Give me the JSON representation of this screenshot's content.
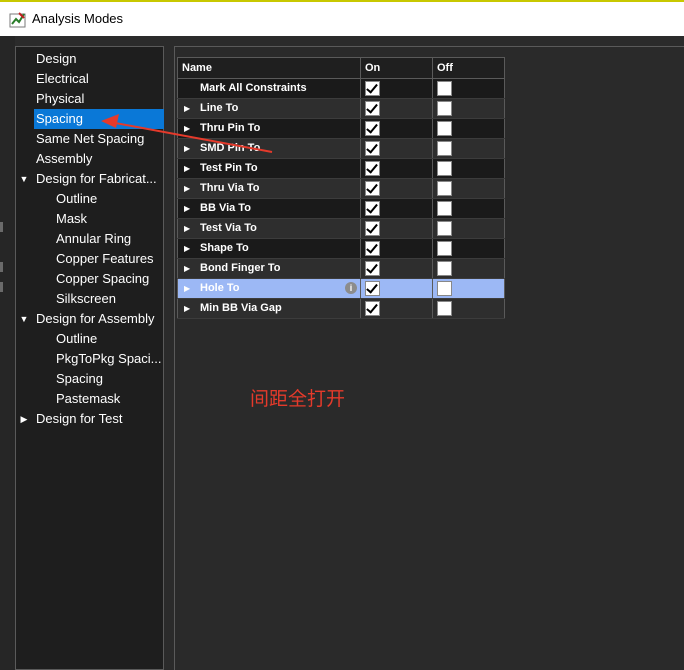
{
  "window": {
    "title": "Analysis Modes"
  },
  "tree": [
    {
      "label": "Design",
      "level": 0,
      "expander": ""
    },
    {
      "label": "Electrical",
      "level": 0,
      "expander": ""
    },
    {
      "label": "Physical",
      "level": 0,
      "expander": ""
    },
    {
      "label": "Spacing",
      "level": 0,
      "expander": "",
      "selected": true
    },
    {
      "label": "Same Net Spacing",
      "level": 0,
      "expander": ""
    },
    {
      "label": "Assembly",
      "level": 0,
      "expander": ""
    },
    {
      "label": "Design for Fabricat...",
      "level": 0,
      "expander": "expanded"
    },
    {
      "label": "Outline",
      "level": 1,
      "expander": ""
    },
    {
      "label": "Mask",
      "level": 1,
      "expander": ""
    },
    {
      "label": "Annular Ring",
      "level": 1,
      "expander": ""
    },
    {
      "label": "Copper Features",
      "level": 1,
      "expander": ""
    },
    {
      "label": "Copper Spacing",
      "level": 1,
      "expander": ""
    },
    {
      "label": "Silkscreen",
      "level": 1,
      "expander": ""
    },
    {
      "label": "Design for Assembly",
      "level": 0,
      "expander": "expanded"
    },
    {
      "label": "Outline",
      "level": 1,
      "expander": ""
    },
    {
      "label": "PkgToPkg Spaci...",
      "level": 1,
      "expander": ""
    },
    {
      "label": "Spacing",
      "level": 1,
      "expander": ""
    },
    {
      "label": "Pastemask",
      "level": 1,
      "expander": ""
    },
    {
      "label": "Design for Test",
      "level": 0,
      "expander": "collapsed"
    }
  ],
  "grid": {
    "headers": {
      "name": "Name",
      "on": "On",
      "off": "Off"
    },
    "rows": [
      {
        "name": "Mark All Constraints",
        "expandable": false,
        "on": true,
        "off": false
      },
      {
        "name": "Line To",
        "expandable": true,
        "on": true,
        "off": false
      },
      {
        "name": "Thru Pin To",
        "expandable": true,
        "on": true,
        "off": false
      },
      {
        "name": "SMD Pin To",
        "expandable": true,
        "on": true,
        "off": false
      },
      {
        "name": "Test Pin To",
        "expandable": true,
        "on": true,
        "off": false
      },
      {
        "name": "Thru Via To",
        "expandable": true,
        "on": true,
        "off": false
      },
      {
        "name": "BB Via To",
        "expandable": true,
        "on": true,
        "off": false
      },
      {
        "name": "Test Via To",
        "expandable": true,
        "on": true,
        "off": false
      },
      {
        "name": "Shape To",
        "expandable": true,
        "on": true,
        "off": false
      },
      {
        "name": "Bond Finger To",
        "expandable": true,
        "on": true,
        "off": false
      },
      {
        "name": "Hole To",
        "expandable": true,
        "on": true,
        "off": false,
        "selected": true,
        "info": "i"
      },
      {
        "name": "Min BB Via Gap",
        "expandable": true,
        "on": true,
        "off": false
      }
    ]
  },
  "annotation": {
    "text": "间距全打开",
    "color": "#e53a2b"
  },
  "colors": {
    "selection": "#0a78d7",
    "row_selected": "#9cb8f5",
    "background": "#2b2b2b"
  },
  "icons": {
    "app": "analysis-modes-icon",
    "expanded": "triangle-down-icon",
    "collapsed": "triangle-right-icon",
    "info": "info-icon",
    "check": "checkmark-icon"
  }
}
